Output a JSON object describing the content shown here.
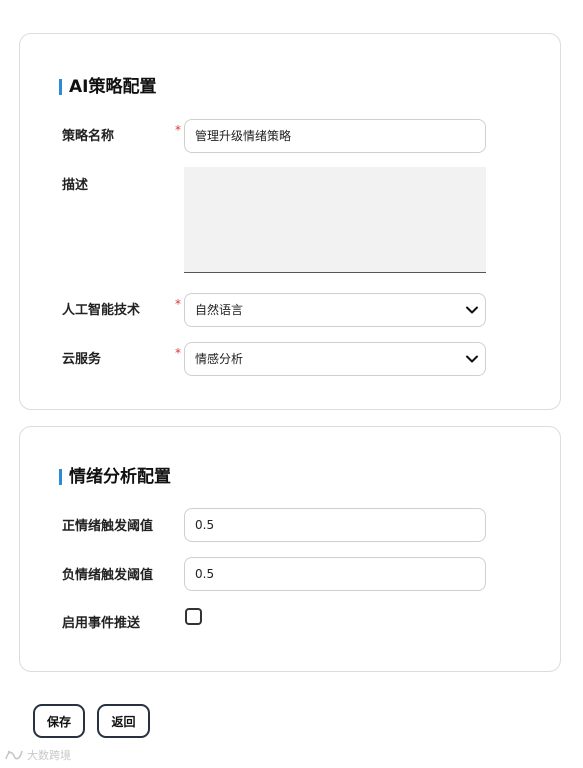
{
  "ai_strategy": {
    "title": "AI策略配置",
    "name": {
      "label": "策略名称",
      "required": "*",
      "value": "管理升级情绪策略"
    },
    "description": {
      "label": "描述",
      "value": ""
    },
    "ai_tech": {
      "label": "人工智能技术",
      "required": "*",
      "selected": "自然语言"
    },
    "cloud_service": {
      "label": "云服务",
      "required": "*",
      "selected": "情感分析"
    }
  },
  "sentiment": {
    "title": "情绪分析配置",
    "positive_threshold": {
      "label": "正情绪触发阈值",
      "value": "0.5"
    },
    "negative_threshold": {
      "label": "负情绪触发阈值",
      "value": "0.5"
    },
    "event_push": {
      "label": "启用事件推送",
      "checked": false
    }
  },
  "actions": {
    "save": "保存",
    "back": "返回"
  },
  "watermark": {
    "text": "大数跨境",
    "icon": "logo-icon"
  },
  "colors": {
    "accent": "#2e8bd0",
    "required": "#d9363e",
    "button_border": "#263240"
  }
}
